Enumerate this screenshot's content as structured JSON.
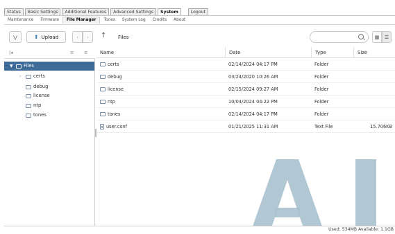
{
  "top_tabs": [
    "Status",
    "Basic Settings",
    "Additional Features",
    "Advanced Settings",
    "System",
    "Logout"
  ],
  "sub_tabs": [
    "Maintenance",
    "Firmware",
    "File Manager",
    "Tones",
    "System Log",
    "Credits",
    "About"
  ],
  "toolbar": {
    "upload_label": "Upload",
    "path_label": "Files",
    "search_placeholder": ""
  },
  "tree": {
    "root_label": "Files",
    "children": [
      "certs",
      "debug",
      "license",
      "ntp",
      "tones"
    ]
  },
  "table": {
    "headers": {
      "name": "Name",
      "date": "Date",
      "type": "Type",
      "size": "Size"
    },
    "rows": [
      {
        "name": "certs",
        "date": "02/14/2024 04:17 PM",
        "type": "Folder",
        "size": "",
        "icon": "folder-icon"
      },
      {
        "name": "debug",
        "date": "03/24/2020 10:26 AM",
        "type": "Folder",
        "size": "",
        "icon": "folder-icon"
      },
      {
        "name": "license",
        "date": "02/15/2024 09:27 AM",
        "type": "Folder",
        "size": "",
        "icon": "folder-icon"
      },
      {
        "name": "ntp",
        "date": "10/04/2024 04:22 PM",
        "type": "Folder",
        "size": "",
        "icon": "folder-icon"
      },
      {
        "name": "tones",
        "date": "02/14/2024 04:17 PM",
        "type": "Folder",
        "size": "",
        "icon": "folder-icon"
      },
      {
        "name": "user.conf",
        "date": "01/21/2025 11:31 AM",
        "type": "Text File",
        "size": "15.706KB",
        "icon": "file-icon"
      }
    ]
  },
  "status": {
    "text": "Used: 534MB  Available: 1.1GB"
  },
  "colors": {
    "selection": "#3f6b99",
    "watermark": "#a9c1cf"
  }
}
